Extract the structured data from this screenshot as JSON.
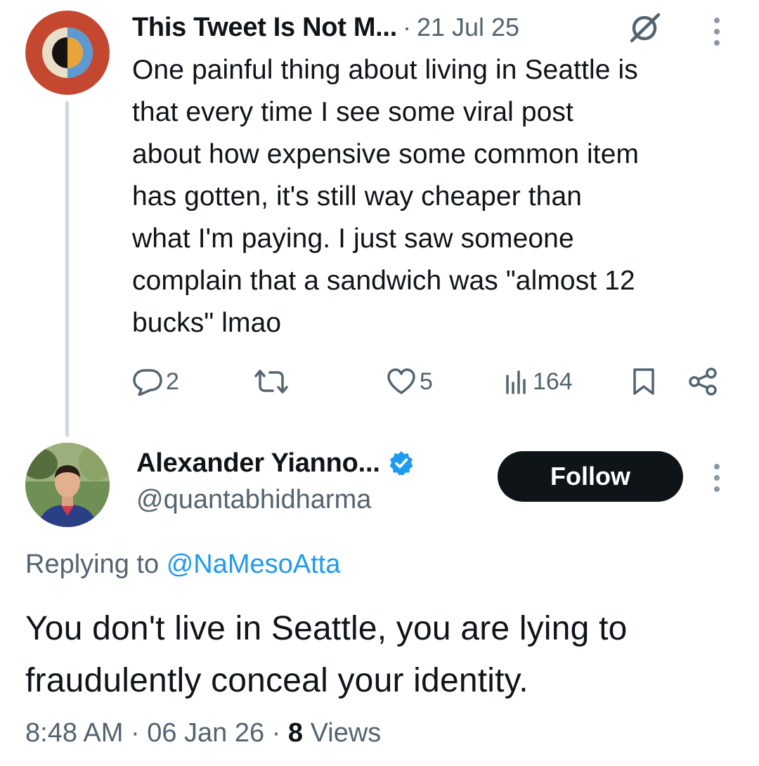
{
  "parent_tweet": {
    "author_name": "This Tweet Is Not M...",
    "separator": "·",
    "date": "21 Jul 25",
    "text": "One painful thing about living in Seattle is\nthat every time I see some viral post\nabout how expensive some common item\nhas gotten, it's still way cheaper than\nwhat I'm paying. I just saw someone\ncomplain that a sandwich was \"almost 12\nbucks\" lmao",
    "actions": {
      "replies": "2",
      "reposts": "",
      "likes": "5",
      "views": "164"
    }
  },
  "reply_tweet": {
    "author_name": "Alexander Yianno...",
    "handle": "@quantabhidharma",
    "follow_label": "Follow",
    "replying_prefix": "Replying to",
    "replying_to": "@NaMesoAtta",
    "text": "You don't live in Seattle, you are lying to fraudulently conceal your identity.",
    "time": "8:48 AM",
    "separator": "·",
    "date": "06 Jan 26",
    "views_count": "8",
    "views_label": "Views"
  },
  "colors": {
    "text": "#0f1419",
    "secondary": "#536471",
    "link": "#1d9bf0",
    "verified": "#1d9bf0",
    "thread_line": "#cfd9de",
    "follow_bg": "#0f1419"
  },
  "icons": [
    "grok-icon",
    "more-icon",
    "reply-icon",
    "repost-icon",
    "like-icon",
    "views-icon",
    "bookmark-icon",
    "share-icon",
    "verified-badge-icon"
  ]
}
